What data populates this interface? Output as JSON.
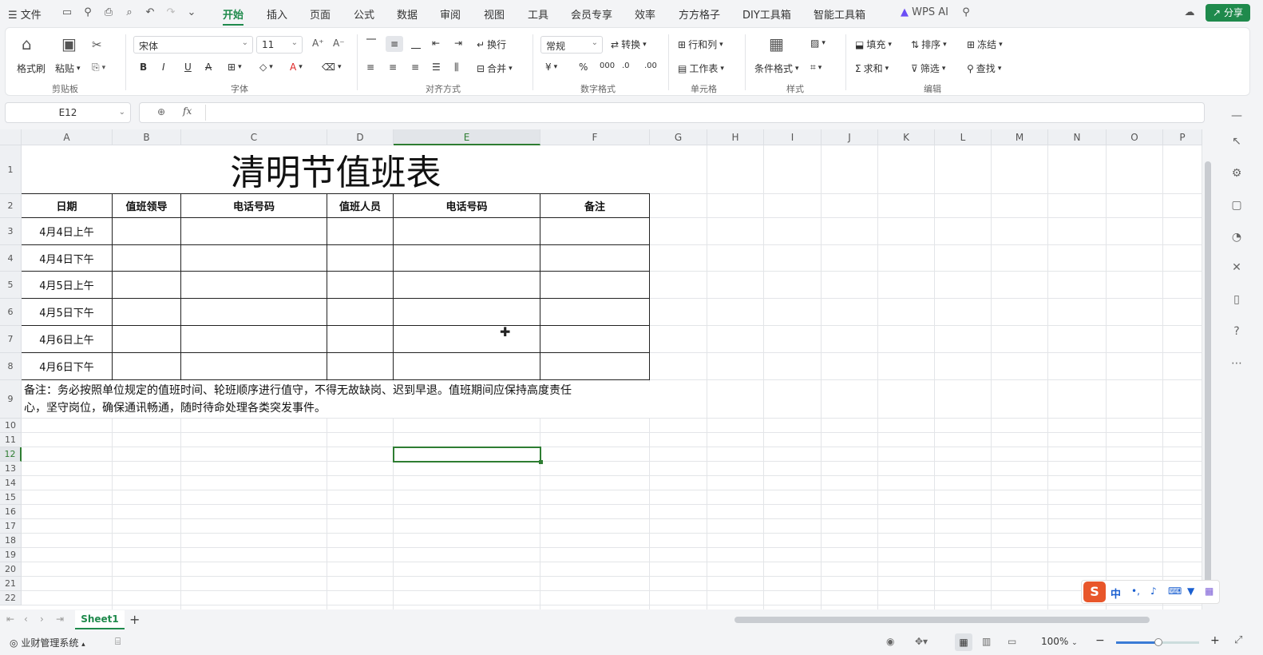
{
  "menu": {
    "file": "文件",
    "tabs": [
      "开始",
      "插入",
      "页面",
      "公式",
      "数据",
      "审阅",
      "视图",
      "工具",
      "会员专享",
      "效率",
      "方方格子",
      "DIY工具箱",
      "智能工具箱"
    ],
    "active_tab": "开始",
    "wps_ai": "WPS AI",
    "share": "分享"
  },
  "ribbon": {
    "clipboard": {
      "format_painter": "格式刷",
      "paste": "粘贴",
      "group": "剪贴板"
    },
    "font": {
      "name": "宋体",
      "size": "11",
      "group": "字体"
    },
    "align": {
      "wrap": "换行",
      "merge": "合并",
      "group": "对齐方式"
    },
    "number": {
      "format": "常规",
      "convert": "转换",
      "group": "数字格式"
    },
    "cells": {
      "rows_cols": "行和列",
      "worksheet": "工作表",
      "group": "单元格"
    },
    "styles": {
      "cond_format": "条件格式",
      "group": "样式"
    },
    "edit": {
      "fill": "填充",
      "sort": "排序",
      "freeze": "冻结",
      "sum": "求和",
      "filter": "筛选",
      "find": "查找",
      "group": "编辑"
    }
  },
  "formula_bar": {
    "name_box": "E12",
    "fx": "fx",
    "value": ""
  },
  "columns": [
    "A",
    "B",
    "C",
    "D",
    "E",
    "F",
    "G",
    "H",
    "I",
    "J",
    "K",
    "L",
    "M",
    "N",
    "O",
    "P"
  ],
  "rows": [
    "1",
    "2",
    "3",
    "4",
    "5",
    "6",
    "7",
    "8",
    "9",
    "10",
    "11",
    "12",
    "13",
    "14",
    "15",
    "16",
    "17",
    "18",
    "19",
    "20",
    "21",
    "22"
  ],
  "sheet": {
    "title": "清明节值班表",
    "headers": [
      "日期",
      "值班领导",
      "电话号码",
      "值班人员",
      "电话号码",
      "备注"
    ],
    "dates": [
      "4月4日上午",
      "4月4日下午",
      "4月5日上午",
      "4月5日下午",
      "4月6日上午",
      "4月6日下午"
    ],
    "note_line1": "备注：务必按照单位规定的值班时间、轮班顺序进行值守，不得无故缺岗、迟到早退。值班期间应保持高度责任",
    "note_line2": "心，坚守岗位，确保通讯畅通，随时待命处理各类突发事件。"
  },
  "sheet_tabs": {
    "active": "Sheet1",
    "add": "+"
  },
  "status": {
    "left": "业财管理系统",
    "zoom": "100%"
  },
  "ime": {
    "label": "中"
  },
  "colors": {
    "accent": "#1f8a4c",
    "selection": "#2e7d32",
    "border": "#222222"
  }
}
